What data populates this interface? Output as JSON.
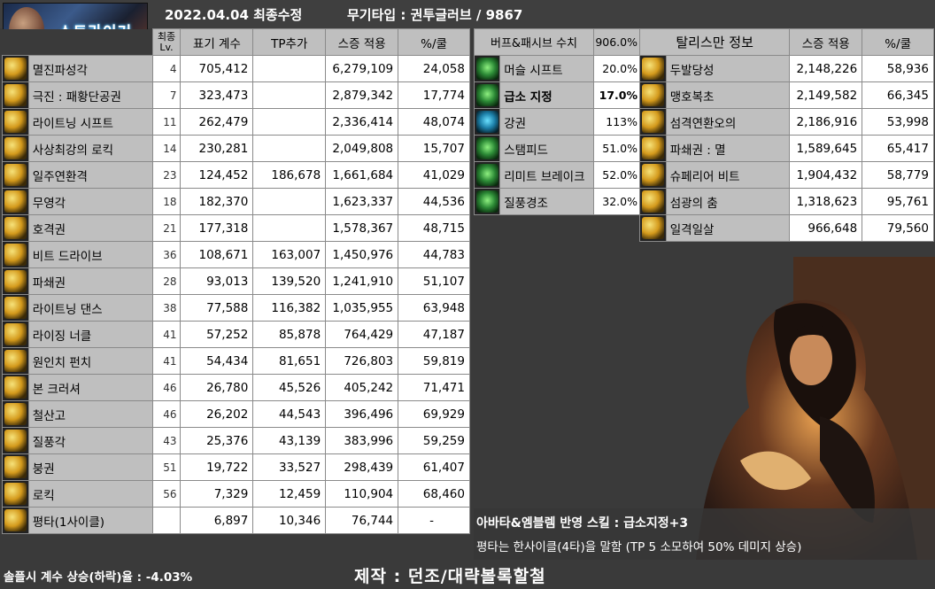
{
  "header": {
    "logo_text": "스트라이커",
    "date_label": "2022.04.04 최종수정",
    "weapon_label": "무기타입 : 권투글러브 / 9867"
  },
  "skill_table": {
    "headers": {
      "lv_top": "최종",
      "lv_bottom": "Lv.",
      "coef": "표기 계수",
      "tp": "TP추가",
      "applied": "스증 적용",
      "per_cool": "%/쿨"
    },
    "rows": [
      {
        "icon": "gold",
        "name": "멸진파성각",
        "lv": "4",
        "coef": "705,412",
        "tp": "",
        "applied": "6,279,109",
        "per_cool": "24,058"
      },
      {
        "icon": "gold",
        "name": "극진 : 패황단공권",
        "lv": "7",
        "coef": "323,473",
        "tp": "",
        "applied": "2,879,342",
        "per_cool": "17,774"
      },
      {
        "icon": "gold",
        "name": "라이트닝 시프트",
        "lv": "11",
        "coef": "262,479",
        "tp": "",
        "applied": "2,336,414",
        "per_cool": "48,074"
      },
      {
        "icon": "gold",
        "name": "사상최강의 로킥",
        "lv": "14",
        "coef": "230,281",
        "tp": "",
        "applied": "2,049,808",
        "per_cool": "15,707"
      },
      {
        "icon": "gold",
        "name": "일주연환격",
        "lv": "23",
        "coef": "124,452",
        "tp": "186,678",
        "applied": "1,661,684",
        "per_cool": "41,029"
      },
      {
        "icon": "gold",
        "name": "무영각",
        "lv": "18",
        "coef": "182,370",
        "tp": "",
        "applied": "1,623,337",
        "per_cool": "44,536"
      },
      {
        "icon": "gold",
        "name": "호격권",
        "lv": "21",
        "coef": "177,318",
        "tp": "",
        "applied": "1,578,367",
        "per_cool": "48,715"
      },
      {
        "icon": "gold",
        "name": "비트 드라이브",
        "lv": "36",
        "coef": "108,671",
        "tp": "163,007",
        "applied": "1,450,976",
        "per_cool": "44,783"
      },
      {
        "icon": "gold",
        "name": "파쇄권",
        "lv": "28",
        "coef": "93,013",
        "tp": "139,520",
        "applied": "1,241,910",
        "per_cool": "51,107"
      },
      {
        "icon": "gold",
        "name": "라이트닝 댄스",
        "lv": "38",
        "coef": "77,588",
        "tp": "116,382",
        "applied": "1,035,955",
        "per_cool": "63,948"
      },
      {
        "icon": "gold",
        "name": "라이징 너클",
        "lv": "41",
        "coef": "57,252",
        "tp": "85,878",
        "applied": "764,429",
        "per_cool": "47,187"
      },
      {
        "icon": "gold",
        "name": "원인치 펀치",
        "lv": "41",
        "coef": "54,434",
        "tp": "81,651",
        "applied": "726,803",
        "per_cool": "59,819"
      },
      {
        "icon": "gold",
        "name": "본 크러셔",
        "lv": "46",
        "coef": "26,780",
        "tp": "45,526",
        "applied": "405,242",
        "per_cool": "71,471"
      },
      {
        "icon": "gold",
        "name": "철산고",
        "lv": "46",
        "coef": "26,202",
        "tp": "44,543",
        "applied": "396,496",
        "per_cool": "69,929"
      },
      {
        "icon": "gold",
        "name": "질풍각",
        "lv": "43",
        "coef": "25,376",
        "tp": "43,139",
        "applied": "383,996",
        "per_cool": "59,259"
      },
      {
        "icon": "gold",
        "name": "붕권",
        "lv": "51",
        "coef": "19,722",
        "tp": "33,527",
        "applied": "298,439",
        "per_cool": "61,407"
      },
      {
        "icon": "gold",
        "name": "로킥",
        "lv": "56",
        "coef": "7,329",
        "tp": "12,459",
        "applied": "110,904",
        "per_cool": "68,460"
      },
      {
        "icon": "gold",
        "name": "평타(1사이클)",
        "lv": "",
        "coef": "6,897",
        "tp": "10,346",
        "applied": "76,744",
        "per_cool": "-"
      }
    ]
  },
  "buff_table": {
    "header_label": "버프&패시브 수치",
    "header_value": "906.0%",
    "rows": [
      {
        "icon": "green",
        "name": "머슬 시프트",
        "value": "20.0%"
      },
      {
        "icon": "green",
        "name": "급소 지정",
        "value": "17.0%"
      },
      {
        "icon": "cyan",
        "name": "강권",
        "value": "113%"
      },
      {
        "icon": "green",
        "name": "스탬피드",
        "value": "51.0%"
      },
      {
        "icon": "green",
        "name": "리미트 브레이크",
        "value": "52.0%"
      },
      {
        "icon": "green",
        "name": "질풍경조",
        "value": "32.0%"
      }
    ]
  },
  "talisman_table": {
    "headers": {
      "info": "탈리스만 정보",
      "applied": "스증 적용",
      "per_cool": "%/쿨"
    },
    "rows": [
      {
        "icon": "gold",
        "name": "두발당성",
        "applied": "2,148,226",
        "per_cool": "58,936"
      },
      {
        "icon": "gold",
        "name": "맹호복초",
        "applied": "2,149,582",
        "per_cool": "66,345"
      },
      {
        "icon": "gold",
        "name": "섬격연환오의",
        "applied": "2,186,916",
        "per_cool": "53,998"
      },
      {
        "icon": "gold",
        "name": "파쇄권 : 멸",
        "applied": "1,589,645",
        "per_cool": "65,417"
      },
      {
        "icon": "gold",
        "name": "슈페리어 비트",
        "applied": "1,904,432",
        "per_cool": "58,779"
      },
      {
        "icon": "gold",
        "name": "섬광의 춤",
        "applied": "1,318,623",
        "per_cool": "95,761"
      },
      {
        "icon": "gold",
        "name": "일격일살",
        "applied": "966,648",
        "per_cool": "79,560"
      }
    ]
  },
  "footer": {
    "solo_text": "솔플시 계수 상승(하락)율 : -4.03%",
    "credit": "제작 : 던조/대략볼록할철",
    "note_line1": "아바타&엠블렘 반영 스킬 : 급소지정+3",
    "note_line2": "평타는 한사이클(4타)을 말함 (TP 5 소모하여 50% 데미지 상승)"
  }
}
